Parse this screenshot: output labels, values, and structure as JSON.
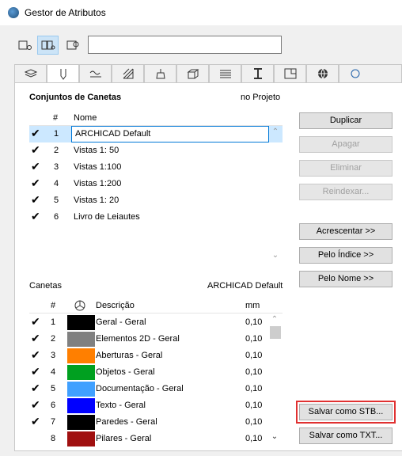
{
  "window": {
    "title": "Gestor de Atributos"
  },
  "search": {
    "value": ""
  },
  "pen_sets": {
    "heading": "Conjuntos de Canetas",
    "scope": "no Projeto",
    "columns": {
      "num": "#",
      "name": "Nome"
    },
    "rows": [
      {
        "num": "1",
        "name": "ARCHICAD Default",
        "checked": "✔"
      },
      {
        "num": "2",
        "name": "Vistas 1: 50",
        "checked": "✔"
      },
      {
        "num": "3",
        "name": "Vistas 1:100",
        "checked": "✔"
      },
      {
        "num": "4",
        "name": "Vistas 1:200",
        "checked": "✔"
      },
      {
        "num": "5",
        "name": "Vistas 1: 20",
        "checked": "✔"
      },
      {
        "num": "6",
        "name": "Livro de Leiautes",
        "checked": "✔"
      }
    ]
  },
  "buttons": {
    "duplicar": "Duplicar",
    "apagar": "Apagar",
    "eliminar": "Eliminar",
    "reindexar": "Reindexar...",
    "acrescentar": "Acrescentar >>",
    "pelo_indice": "Pelo Índice >>",
    "pelo_nome": "Pelo Nome >>",
    "salvar_stb": "Salvar como STB...",
    "salvar_txt": "Salvar como TXT..."
  },
  "pens": {
    "heading": "Canetas",
    "set_name": "ARCHICAD Default",
    "columns": {
      "num": "#",
      "desc": "Descrição",
      "mm": "mm"
    },
    "rows": [
      {
        "num": "1",
        "desc": "Geral - Geral",
        "mm": "0,10",
        "color": "#000000",
        "checked": "✔"
      },
      {
        "num": "2",
        "desc": "Elementos 2D - Geral",
        "mm": "0,10",
        "color": "#808080",
        "checked": "✔"
      },
      {
        "num": "3",
        "desc": "Aberturas - Geral",
        "mm": "0,10",
        "color": "#ff7f00",
        "checked": "✔"
      },
      {
        "num": "4",
        "desc": "Objetos - Geral",
        "mm": "0,10",
        "color": "#00a020",
        "checked": "✔"
      },
      {
        "num": "5",
        "desc": "Documentação - Geral",
        "mm": "0,10",
        "color": "#40a0ff",
        "checked": "✔"
      },
      {
        "num": "6",
        "desc": "Texto - Geral",
        "mm": "0,10",
        "color": "#0000ff",
        "checked": "✔"
      },
      {
        "num": "7",
        "desc": "Paredes - Geral",
        "mm": "0,10",
        "color": "#000000",
        "checked": "✔"
      },
      {
        "num": "8",
        "desc": "Pilares - Geral",
        "mm": "0,10",
        "color": "#a01010",
        "checked": ""
      }
    ]
  }
}
